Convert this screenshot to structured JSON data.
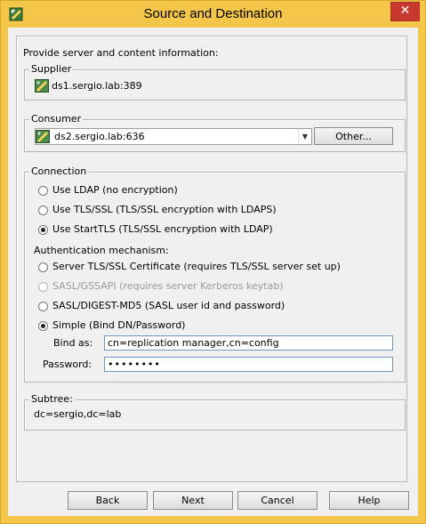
{
  "window": {
    "title": "Source and Destination",
    "close_glyph": "✕",
    "icon": "app-icon"
  },
  "intro_text": "Provide server and content information:",
  "supplier": {
    "legend": "Supplier",
    "server": "ds1.sergio.lab:389",
    "icon": "server-icon"
  },
  "consumer": {
    "legend": "Consumer",
    "selected_server": "ds2.sergio.lab:636",
    "other_button": "Other...",
    "icon": "server-icon"
  },
  "connection": {
    "legend": "Connection",
    "options": [
      {
        "label": "Use LDAP (no encryption)",
        "checked": false
      },
      {
        "label": "Use TLS/SSL (TLS/SSL encryption with LDAPS)",
        "checked": false
      },
      {
        "label": "Use StartTLS (TLS/SSL encryption with LDAP)",
        "checked": true
      }
    ],
    "auth_heading": "Authentication mechanism:",
    "auth_options": [
      {
        "label": "Server TLS/SSL Certificate (requires TLS/SSL server set up)",
        "checked": false,
        "enabled": true
      },
      {
        "label": "SASL/GSSAPI (requires server Kerberos keytab)",
        "checked": false,
        "enabled": false
      },
      {
        "label": "SASL/DIGEST-MD5 (SASL user id and password)",
        "checked": false,
        "enabled": true
      },
      {
        "label": "Simple (Bind DN/Password)",
        "checked": true,
        "enabled": true
      }
    ],
    "bind_as_label": "Bind as:",
    "bind_as_value": "cn=replication manager,cn=config",
    "password_label": "Password:",
    "password_value": "••••••••"
  },
  "subtree": {
    "legend": "Subtree:",
    "value": "dc=sergio,dc=lab"
  },
  "buttons": {
    "back": "Back",
    "next": "Next",
    "cancel": "Cancel",
    "help": "Help"
  },
  "colors": {
    "window_frame": "#f4c74a",
    "close_button": "#c7392e",
    "input_border": "#6f96be"
  }
}
